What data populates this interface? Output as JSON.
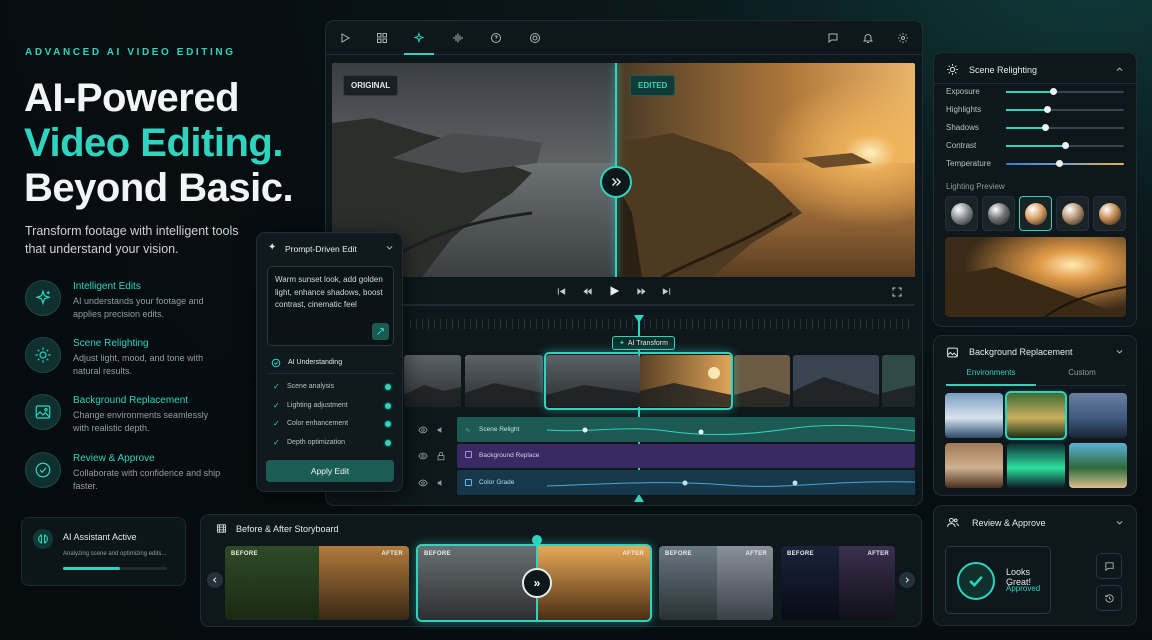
{
  "hero": {
    "eyebrow": "ADVANCED AI VIDEO EDITING",
    "title_line1": "AI-Powered",
    "title_line2": "Video Editing.",
    "title_line3": "Beyond Basic.",
    "subtitle": "Transform footage with intelligent tools that understand your vision.",
    "features": [
      {
        "title": "Intelligent Edits",
        "desc": "AI understands your footage and applies precision edits.",
        "icon": "sparkle-icon"
      },
      {
        "title": "Scene Relighting",
        "desc": "Adjust light, mood, and tone with natural results.",
        "icon": "sun-icon"
      },
      {
        "title": "Background Replacement",
        "desc": "Change environments seamlessly with realistic depth.",
        "icon": "image-icon"
      },
      {
        "title": "Review & Approve",
        "desc": "Collaborate with confidence and ship faster.",
        "icon": "check-circle-icon"
      }
    ]
  },
  "assistant": {
    "title": "AI Assistant Active",
    "status": "Analyzing scene and optimizing edits...",
    "progress": 0.55
  },
  "toolbar": {
    "left_icons": [
      "play-icon",
      "grid-icon",
      "ai-sparkle-icon",
      "audio-wave-icon",
      "help-icon",
      "target-icon"
    ],
    "right_icons": [
      "comment-icon",
      "bell-icon",
      "gear-icon"
    ],
    "active_index": 2
  },
  "preview": {
    "original_label": "ORIGINAL",
    "edited_label": "EDITED"
  },
  "prompt": {
    "title": "Prompt-Driven Edit",
    "text": "Warm sunset look, add golden light, enhance shadows, boost contrast, cinematic feel",
    "understanding_title": "AI Understanding",
    "items": [
      "Scene analysis",
      "Lighting adjustment",
      "Color enhancement",
      "Depth optimization"
    ],
    "apply_label": "Apply Edit"
  },
  "timeline": {
    "ai_transform_label": "AI Transform",
    "tracks": [
      {
        "name": "Scene Relight",
        "color": "#1c5a52",
        "locked": false
      },
      {
        "name": "Background Replace",
        "color": "#3a2a63",
        "locked": true
      },
      {
        "name": "Color Grade",
        "color": "#16384a",
        "locked": false
      }
    ]
  },
  "relight": {
    "title": "Scene Relighting",
    "sliders": [
      {
        "name": "Exposure",
        "value": 0.4
      },
      {
        "name": "Highlights",
        "value": 0.35
      },
      {
        "name": "Shadows",
        "value": 0.33
      },
      {
        "name": "Contrast",
        "value": 0.5
      },
      {
        "name": "Temperature",
        "value": 0.45
      }
    ],
    "preview_label": "Lighting Preview",
    "selected_sphere": 2
  },
  "background": {
    "title": "Background Replacement",
    "tabs": [
      "Environments",
      "Custom"
    ],
    "active_tab": 0,
    "selected": 1
  },
  "review": {
    "title": "Review & Approve",
    "status_title": "Looks Great!",
    "status_sub": "Approved"
  },
  "storyboard": {
    "title": "Before & After Storyboard",
    "before_label": "BEFORE",
    "after_label": "AFTER"
  },
  "colors": {
    "accent": "#2fd4bf",
    "bg": "#070e11",
    "panel": "#0e171b"
  }
}
